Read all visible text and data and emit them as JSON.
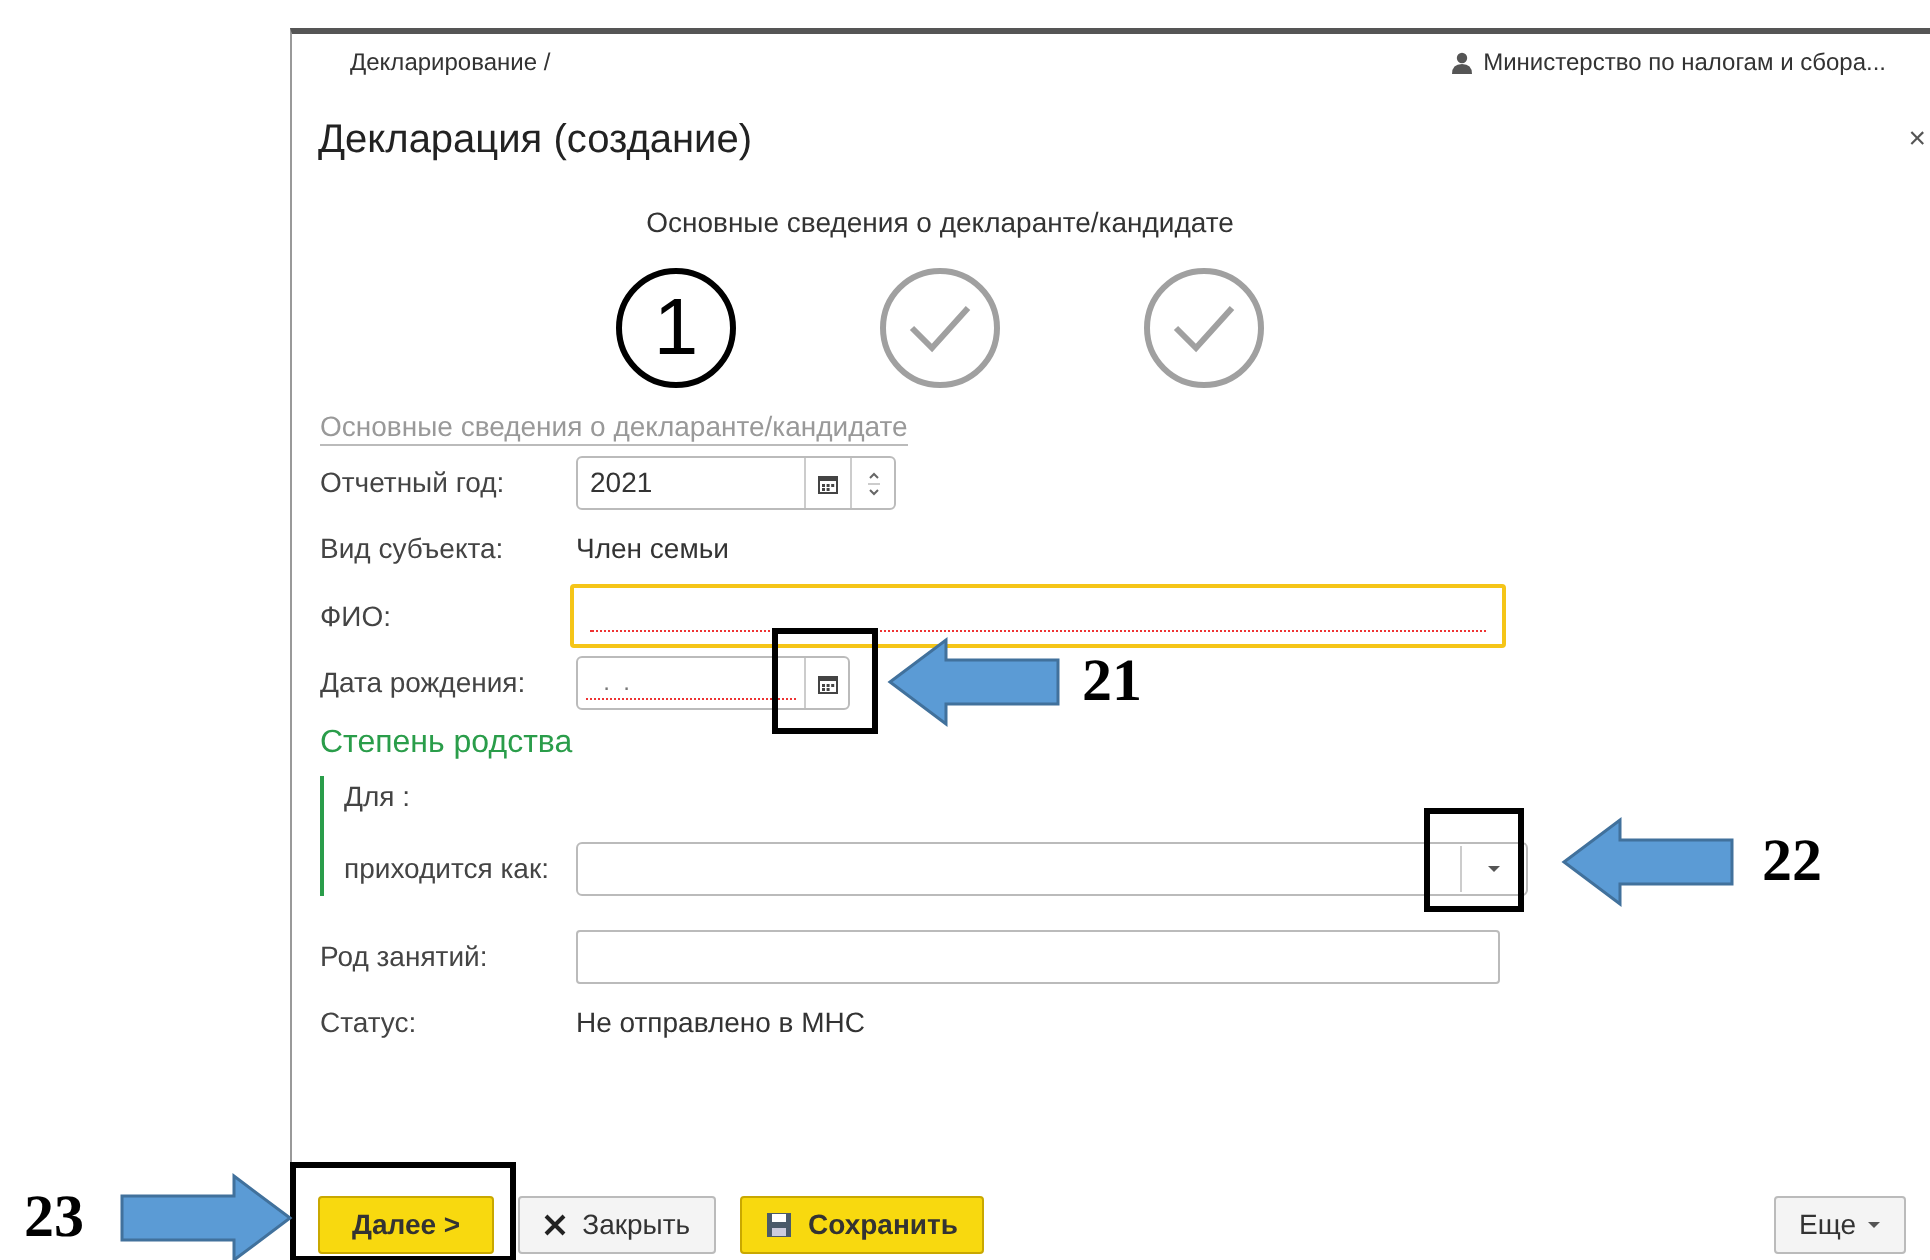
{
  "breadcrumb": "Декларирование /",
  "user": "Министерство по налогам и сбора...",
  "title": "Декларация (создание)",
  "close": "×",
  "stepper": {
    "label": "Основные сведения о декларанте/кандидате",
    "steps": [
      {
        "selected": true,
        "number": "1"
      },
      {
        "selected": false
      },
      {
        "selected": false
      }
    ]
  },
  "section_link": "Основные сведения о декларанте/кандидате",
  "fields": [
    {
      "kind": "year",
      "label": "Отчетный год:",
      "value": "2021"
    },
    {
      "kind": "text",
      "label": "Вид субъекта:",
      "value": "Член семьи"
    },
    {
      "kind": "input",
      "label": "ФИО:",
      "focused": true,
      "required": true
    },
    {
      "kind": "date",
      "label": "Дата рождения:",
      "placeholder": "  .  .",
      "required": true,
      "callout": "21"
    }
  ],
  "relation": {
    "title": "Степень родства",
    "for_label": "Для :",
    "as_label": "приходится как:",
    "callout": "22"
  },
  "fields2": [
    {
      "kind": "input",
      "label": "Род занятий:",
      "focused": false,
      "required": false
    },
    {
      "kind": "text",
      "label": "Статус:",
      "value": "Не отправлено в МНС"
    }
  ],
  "buttons": [
    {
      "kind": "primary",
      "label": "Далее >",
      "callout": "23"
    },
    {
      "kind": "close",
      "label": "Закрыть"
    },
    {
      "kind": "save",
      "label": "Сохранить"
    }
  ],
  "more": "Еще"
}
